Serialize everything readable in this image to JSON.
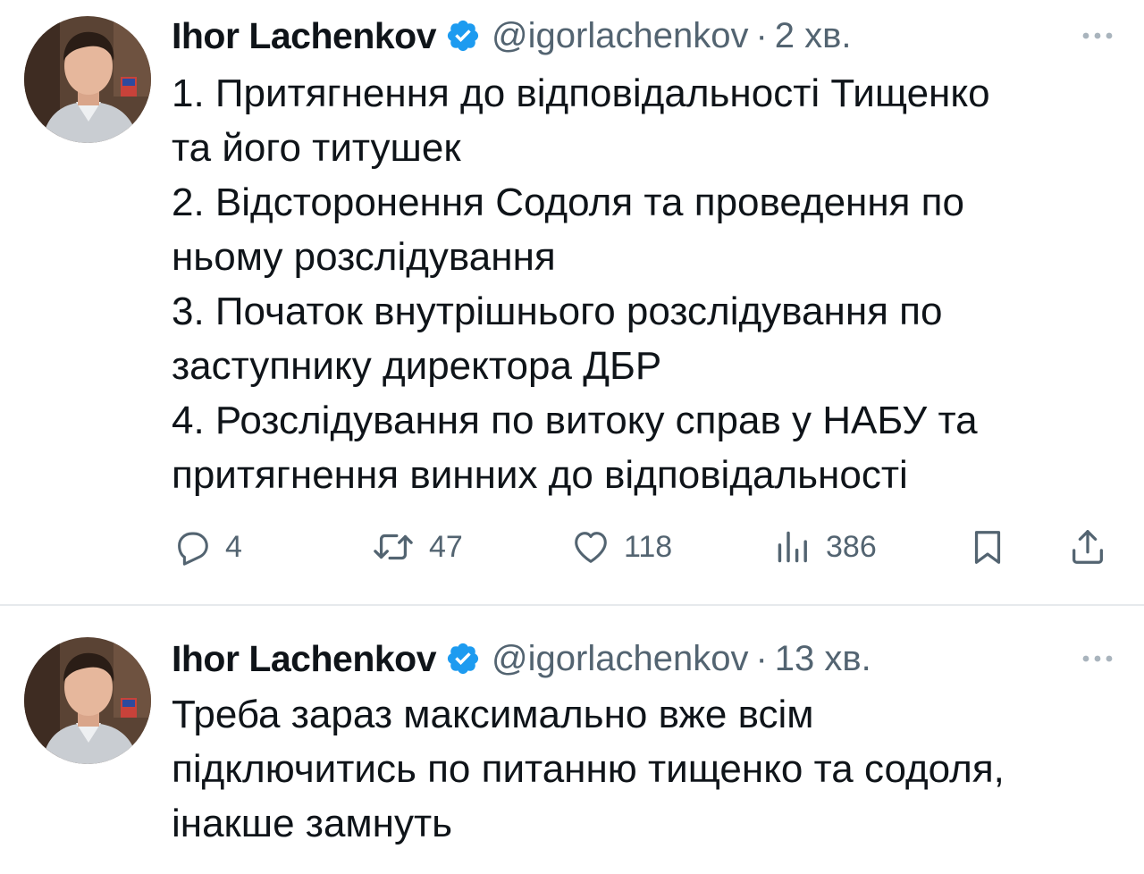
{
  "tweets": [
    {
      "author": {
        "name": "Ihor Lachenkov",
        "handle": "@igorlachenkov",
        "verified": true,
        "avatar_icon": "profile-photo"
      },
      "separator": "·",
      "time": "2 хв.",
      "text": "1. Притягнення до відповідальності Тищенко\nта його титушек\n2. Відсторонення Содоля та проведення по\nньому розслідування\n3. Початок внутрішнього розслідування по\nзаступнику директора ДБР\n4. Розслідування по витоку справ у НАБУ та\nпритягнення винних до відповідальності",
      "stats": {
        "replies": "4",
        "retweets": "47",
        "likes": "118",
        "views": "386"
      }
    },
    {
      "author": {
        "name": "Ihor Lachenkov",
        "handle": "@igorlachenkov",
        "verified": true,
        "avatar_icon": "profile-photo"
      },
      "separator": "·",
      "time": "13 хв.",
      "text": "Треба зараз максимально вже всім\nпідключитись по питанню тищенко та содоля,\nінакше замнуть"
    }
  ],
  "colors": {
    "verified_badge": "#1d9bf0",
    "secondary_text": "#536471",
    "primary_text": "#0f1419",
    "divider": "#e6e9ec"
  }
}
